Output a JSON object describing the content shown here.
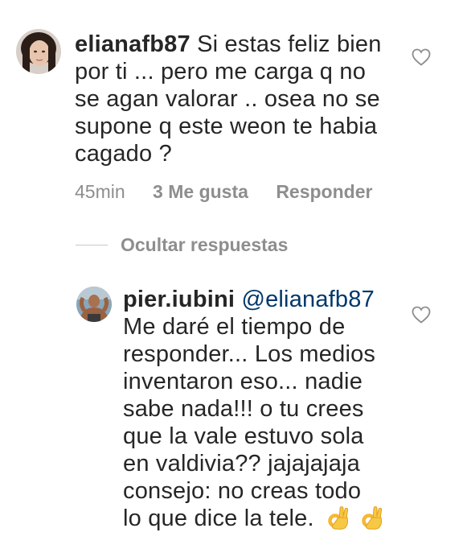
{
  "comments": [
    {
      "username": "elianafb87",
      "text_lines": [
        "Si estas feliz bien",
        "por ti ... pero me carga q no",
        "se agan valorar .. osea no se",
        "supone q este weon te habia",
        "cagado ?"
      ],
      "time": "45min",
      "likes": "3 Me gusta",
      "reply_label": "Responder"
    }
  ],
  "hide_replies_label": "Ocultar respuestas",
  "reply": {
    "username": "pier.iubini",
    "mention": "@elianafb87",
    "text_lines": [
      "Me daré el tiempo de",
      "responder... Los medios",
      "inventaron eso... nadie",
      "sabe nada!!! o tu crees",
      "que la vale estuvo sola",
      "en valdivia?? jajajajaja",
      "consejo: no creas todo",
      "lo que dice la tele."
    ],
    "emojis": [
      "ok-hand-emoji",
      "ok-hand-emoji"
    ]
  },
  "icons": {
    "like": "heart-outline-icon"
  },
  "colors": {
    "text": "#262626",
    "meta": "#8e8e8e",
    "mention": "#00376b"
  }
}
